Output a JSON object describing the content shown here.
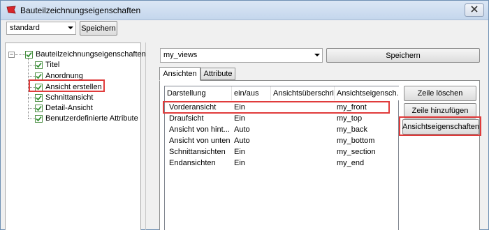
{
  "window": {
    "title": "Bauteilzeichnungseigenschaften"
  },
  "toolbar": {
    "preset_value": "standard",
    "save_label": "Speichern"
  },
  "tree": {
    "root_label": "Bauteilzeichnungseigenschaften",
    "items": [
      {
        "label": "Titel"
      },
      {
        "label": "Anordnung"
      },
      {
        "label": "Ansicht erstellen"
      },
      {
        "label": "Schnittansicht"
      },
      {
        "label": "Detail-Ansicht"
      },
      {
        "label": "Benutzerdefinierte Attribute"
      }
    ]
  },
  "views": {
    "preset_value": "my_views",
    "save_label": "Speichern"
  },
  "tabs": [
    {
      "label": "Ansichten"
    },
    {
      "label": "Attribute"
    }
  ],
  "table": {
    "columns": [
      "Darstellung",
      "ein/aus",
      "Ansichtsüberschrift",
      "Ansichtseigensch..."
    ],
    "rows": [
      [
        "Vorderansicht",
        "Ein",
        "",
        "my_front"
      ],
      [
        "Draufsicht",
        "Ein",
        "",
        "my_top"
      ],
      [
        "Ansicht von hint...",
        "Auto",
        "",
        "my_back"
      ],
      [
        "Ansicht von unten",
        "Auto",
        "",
        "my_bottom"
      ],
      [
        "Schnittansichten",
        "Ein",
        "",
        "my_section"
      ],
      [
        "Endansichten",
        "Ein",
        "",
        "my_end"
      ]
    ]
  },
  "actions": {
    "delete_row": "Zeile löschen",
    "add_row": "Zeile hinzufügen",
    "view_properties": "Ansichtseigenschaften"
  },
  "colors": {
    "highlight": "#e03b3b",
    "check": "#2f8f2f",
    "titlebar": "#c4d6ec"
  }
}
